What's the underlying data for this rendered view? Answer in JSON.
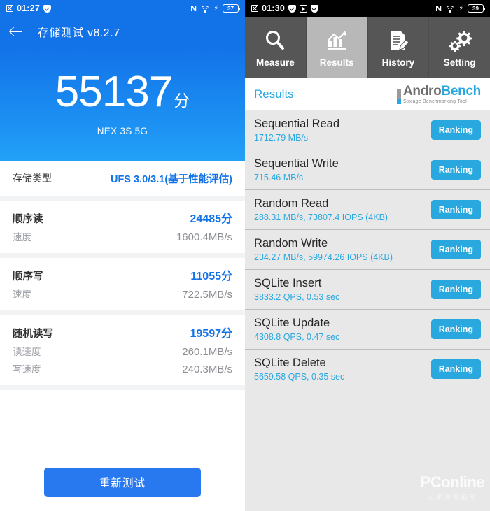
{
  "left_panel": {
    "status_bar": {
      "time": "01:27",
      "battery": "37",
      "network_label": "N",
      "icons": [
        "screenshot-icon",
        "shield-icon",
        "nfc-icon",
        "wifi-icon",
        "charging-bolt-icon",
        "battery-icon"
      ]
    },
    "app_bar": {
      "back_label": "back-arrow",
      "title": "存储测试 v8.2.7"
    },
    "hero": {
      "score": "55137",
      "unit": "分",
      "device": "NEX 3S 5G"
    },
    "storage_type": {
      "label": "存储类型",
      "value": "UFS 3.0/3.1(基于性能评估)"
    },
    "metrics": [
      {
        "name": "顺序读",
        "score": "24485分",
        "lines": [
          {
            "key": "速度",
            "value": "1600.4MB/s"
          }
        ]
      },
      {
        "name": "顺序写",
        "score": "11055分",
        "lines": [
          {
            "key": "速度",
            "value": "722.5MB/s"
          }
        ]
      },
      {
        "name": "随机读写",
        "score": "19597分",
        "lines": [
          {
            "key": "读速度",
            "value": "260.1MB/s"
          },
          {
            "key": "写速度",
            "value": "240.3MB/s"
          }
        ]
      }
    ],
    "retest_button": "重新测试",
    "colors": {
      "brand": "#1272e8",
      "button": "#2878f0",
      "value": "#1272e8"
    }
  },
  "right_panel": {
    "status_bar": {
      "time": "01:30",
      "battery": "39",
      "network_label": "N",
      "icons": [
        "screenshot-icon",
        "shield-icon",
        "play-icon",
        "check-icon",
        "nfc-icon",
        "wifi-icon",
        "charging-bolt-icon",
        "battery-icon"
      ]
    },
    "tabs": [
      {
        "label": "Measure",
        "icon": "magnifier-icon",
        "active": false
      },
      {
        "label": "Results",
        "icon": "bar-chart-icon",
        "active": true
      },
      {
        "label": "History",
        "icon": "document-pencil-icon",
        "active": false
      },
      {
        "label": "Setting",
        "icon": "gears-icon",
        "active": false
      }
    ],
    "header": {
      "title": "Results",
      "logo_main_a": "Andro",
      "logo_main_b": "Bench",
      "logo_sub": "Storage Benchmarking Tool"
    },
    "results": [
      {
        "name": "Sequential Read",
        "value": "1712.79 MB/s",
        "action": "Ranking"
      },
      {
        "name": "Sequential Write",
        "value": "715.46 MB/s",
        "action": "Ranking"
      },
      {
        "name": "Random Read",
        "value": "288.31 MB/s, 73807.4 IOPS (4KB)",
        "action": "Ranking"
      },
      {
        "name": "Random Write",
        "value": "234.27 MB/s, 59974.26 IOPS (4KB)",
        "action": "Ranking"
      },
      {
        "name": "SQLite Insert",
        "value": "3833.2 QPS, 0.53 sec",
        "action": "Ranking"
      },
      {
        "name": "SQLite Update",
        "value": "4308.8 QPS, 0.47 sec",
        "action": "Ranking"
      },
      {
        "name": "SQLite Delete",
        "value": "5659.58 QPS, 0.35 sec",
        "action": "Ranking"
      }
    ],
    "colors": {
      "accent": "#29a8e0",
      "tab_bg": "#565656",
      "tab_active_bg": "#b8b8b8",
      "list_bg": "#e8e8e8"
    }
  },
  "watermark": {
    "main": "PConline",
    "sub": "太平洋电脑网"
  }
}
